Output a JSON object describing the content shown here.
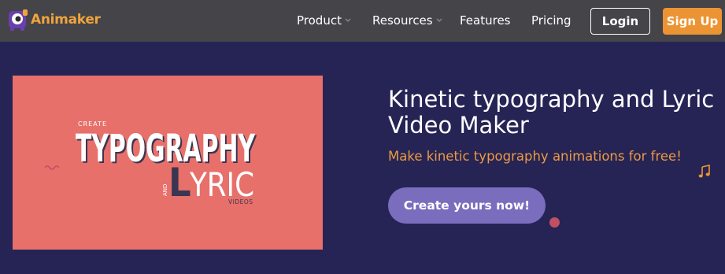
{
  "brand": {
    "name": "Animaker",
    "logo_icon": "animaker-logo-icon",
    "color": "#f0a43c"
  },
  "nav": {
    "product": "Product",
    "resources": "Resources",
    "features": "Features",
    "pricing": "Pricing",
    "login": "Login",
    "signup": "Sign Up"
  },
  "hero": {
    "card": {
      "line1": "CREATE",
      "line2": "TYPOGRAPHY",
      "line3_prefix": "AND",
      "line3_big_letter": "L",
      "line3": "YRIC",
      "line4": "VIDEOS",
      "background": "#e8706b"
    },
    "title": "Kinetic typography and Lyric Video Maker",
    "subtitle": "Make kinetic typography animations for free!",
    "cta": "Create yours now!"
  },
  "decorations": {
    "music_note_icon": "music-note-icon",
    "accent_orange": "#ec9433",
    "accent_purple": "#7b6dbd"
  }
}
